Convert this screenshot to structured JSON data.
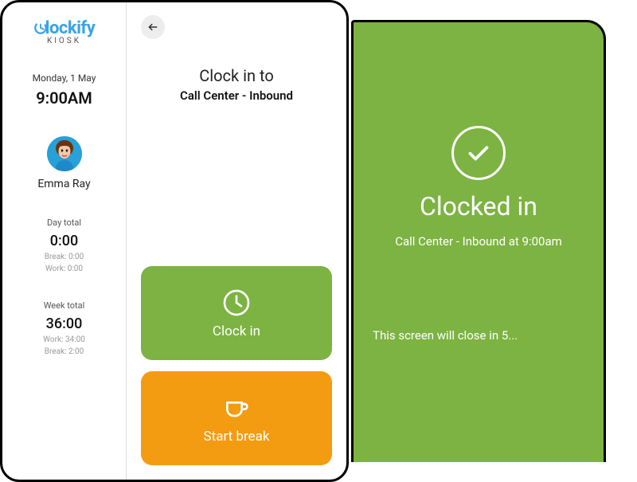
{
  "brand": {
    "name": "Clockify",
    "sub": "KIOSK"
  },
  "sidebar": {
    "date": "Monday, 1 May",
    "time": "9:00AM",
    "username": "Emma Ray",
    "day": {
      "label": "Day total",
      "value": "0:00",
      "break": "Break: 0:00",
      "work": "Work: 0:00"
    },
    "week": {
      "label": "Week total",
      "value": "36:00",
      "work": "Work: 34:00",
      "break": "Break: 2:00"
    }
  },
  "main": {
    "title": "Clock in to",
    "subtitle": "Call Center - Inbound",
    "clockin_label": "Clock in",
    "break_label": "Start break"
  },
  "confirm": {
    "title": "Clocked in",
    "detail": "Call Center - Inbound at 9:00am",
    "close_msg": "This screen will close in 5..."
  },
  "colors": {
    "brand_blue": "#3aa3e3",
    "green": "#7cb342",
    "orange": "#f39c12"
  }
}
